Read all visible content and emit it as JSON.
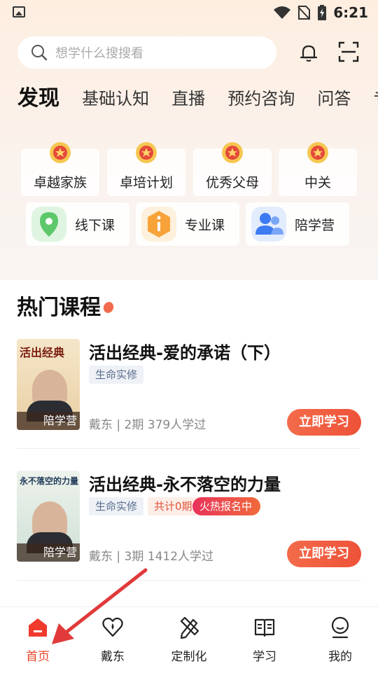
{
  "status_bar": {
    "time": "6:21"
  },
  "search": {
    "placeholder": "想学什么搜搜看"
  },
  "tabs": [
    {
      "label": "发现",
      "active": true
    },
    {
      "label": "基础认知"
    },
    {
      "label": "直播"
    },
    {
      "label": "预约咨询"
    },
    {
      "label": "问答"
    },
    {
      "label": "专家"
    }
  ],
  "awards": [
    {
      "label": "卓越家族",
      "icon": "medal-icon"
    },
    {
      "label": "卓培计划",
      "icon": "medal-icon"
    },
    {
      "label": "优秀父母",
      "icon": "medal-icon"
    },
    {
      "label": "中关",
      "icon": "medal-icon"
    }
  ],
  "features": [
    {
      "label": "线下课",
      "icon": "location-pin-icon",
      "color": "#5cc86a"
    },
    {
      "label": "专业课",
      "icon": "info-hexagon-icon",
      "color": "#f7a33a"
    },
    {
      "label": "陪学营",
      "icon": "users-icon",
      "color": "#3d7bf2"
    }
  ],
  "hot_courses": {
    "title": "热门课程",
    "items": [
      {
        "title": "活出经典-爱的承诺（下）",
        "cover_title": "活出经典",
        "cover_badge": "陪学营",
        "tags": [
          "生命实修"
        ],
        "meta": "戴东 | 2期  379人学过",
        "button": "立即学习"
      },
      {
        "title": "活出经典-永不落空的力量",
        "cover_title": "永不落空的力量",
        "cover_badge": "陪学营",
        "tags": [
          "生命实修",
          "共计0期",
          "火热报名中"
        ],
        "meta": "戴东 | 3期  1412人学过",
        "button": "立即学习"
      }
    ]
  },
  "bottom_nav": [
    {
      "label": "首页",
      "icon": "home-icon",
      "active": true
    },
    {
      "label": "戴东",
      "icon": "heart-icon"
    },
    {
      "label": "定制化",
      "icon": "pencil-ruler-icon"
    },
    {
      "label": "学习",
      "icon": "book-icon"
    },
    {
      "label": "我的",
      "icon": "profile-icon"
    }
  ],
  "colors": {
    "accent": "#ee5238",
    "tag_blue": "#5b6f8f"
  }
}
